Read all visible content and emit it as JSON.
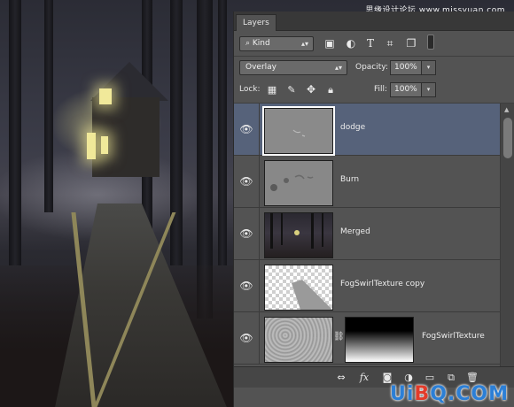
{
  "watermark_top": "思缘设计论坛 www.missyuan.com",
  "watermark_bottom": {
    "prefix": "Ui",
    "o": "B",
    "suffix": "Q.COM"
  },
  "panel": {
    "tab_label": "Layers",
    "filter": {
      "kind_label": "Kind",
      "icons": [
        "image-filter-icon",
        "adjustment-filter-icon",
        "type-filter-icon",
        "shape-filter-icon",
        "smart-object-filter-icon",
        "filter-toggle-icon"
      ]
    },
    "blend_mode": "Overlay",
    "opacity_label": "Opacity:",
    "opacity_value": "100%",
    "lock_label": "Lock:",
    "fill_label": "Fill:",
    "fill_value": "100%",
    "layers": [
      {
        "name": "dodge",
        "selected": true,
        "visible": true
      },
      {
        "name": "Burn",
        "selected": false,
        "visible": true
      },
      {
        "name": "Merged",
        "selected": false,
        "visible": true
      },
      {
        "name": "FogSwirlTexture copy",
        "selected": false,
        "visible": true
      },
      {
        "name": "FogSwirlTexture",
        "selected": false,
        "visible": true,
        "has_mask": true
      }
    ],
    "footer_icons": [
      "link-icon",
      "fx-icon",
      "mask-icon",
      "adjustment-icon",
      "group-folder-icon",
      "new-layer-icon",
      "trash-icon"
    ]
  }
}
